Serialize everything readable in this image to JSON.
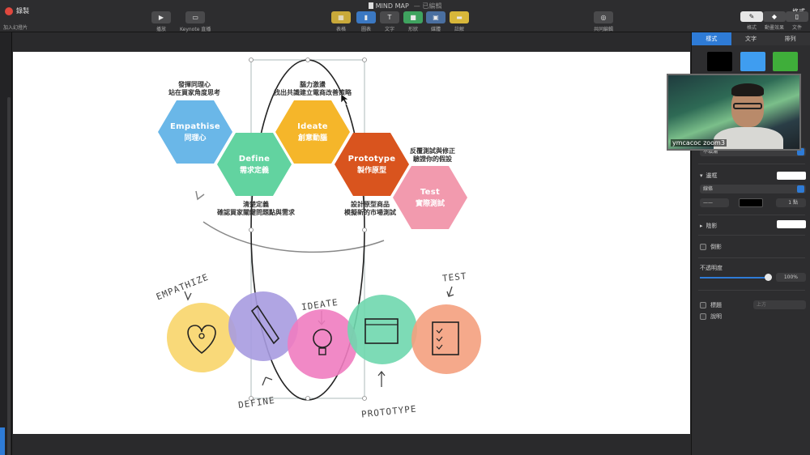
{
  "app": {
    "doc_title": "MIND MAP",
    "doc_status": "— 已編輯",
    "record_label": "錄製",
    "add_slide_label": "加入幻燈片",
    "right_top_label": "格式"
  },
  "toolbar": {
    "play_label": "播放",
    "keynote_live_label": "Keynote 直播",
    "table_label": "表格",
    "chart_label": "圖表",
    "text_label": "文字",
    "shape_label": "形狀",
    "media_label": "媒體",
    "comment_label": "註解",
    "collaborate_label": "共同編輯",
    "format_label": "格式",
    "animate_label": "動畫效果",
    "document_label": "文件"
  },
  "slide": {
    "hexagons": [
      {
        "en": "Empathise",
        "zh": "同理心",
        "color": "#6ab7e8"
      },
      {
        "en": "Define",
        "zh": "需求定義",
        "color": "#62d3a0"
      },
      {
        "en": "Ideate",
        "zh": "創意動腦",
        "color": "#f5b62a"
      },
      {
        "en": "Prototype",
        "zh": "製作原型",
        "color": "#d9541e"
      },
      {
        "en": "Test",
        "zh": "實際測試",
        "color": "#f29aae"
      }
    ],
    "captions": {
      "empathise_1": "發揮同理心",
      "empathise_2": "站在買家角度思考",
      "ideate_1": "腦力激盪",
      "ideate_2": "找出共識建立電商改善策略",
      "test_1": "反覆測試與修正",
      "test_2": "驗證你的假設",
      "define_1": "清楚定義",
      "define_2": "確認買家關鍵問題點與需求",
      "prototype_1": "設計原型商品",
      "prototype_2": "模擬新的市場測試"
    },
    "circles": [
      {
        "name": "empathize",
        "color": "#f8d56a"
      },
      {
        "name": "define",
        "color": "#a79be0"
      },
      {
        "name": "ideate",
        "color": "#f07cc0"
      },
      {
        "name": "prototype",
        "color": "#6fd7ae"
      },
      {
        "name": "test",
        "color": "#f4a07e"
      }
    ],
    "hand_labels": {
      "empathize": "EMPATHIZE",
      "define": "DEFINE",
      "ideate": "IDEATE",
      "prototype": "PROTOTYPE",
      "test": "TEST"
    }
  },
  "inspector": {
    "tabs": [
      "樣式",
      "文字",
      "排列"
    ],
    "swatch_colors": [
      "#000000",
      "#3f9df0",
      "#3fae3a"
    ],
    "fill_select": "不填滿",
    "border_label": "邊框",
    "line_select": "線條",
    "stroke_width": "1 點",
    "shadow_label": "陰影",
    "reflection_label": "倒影",
    "opacity_label": "不透明度",
    "opacity_value": "100%",
    "opacity_fraction": 1.0,
    "title_label": "標題",
    "title_position": "上方",
    "caption_label": "說明"
  },
  "video": {
    "participant_name": "ymcacoc zoom3"
  }
}
